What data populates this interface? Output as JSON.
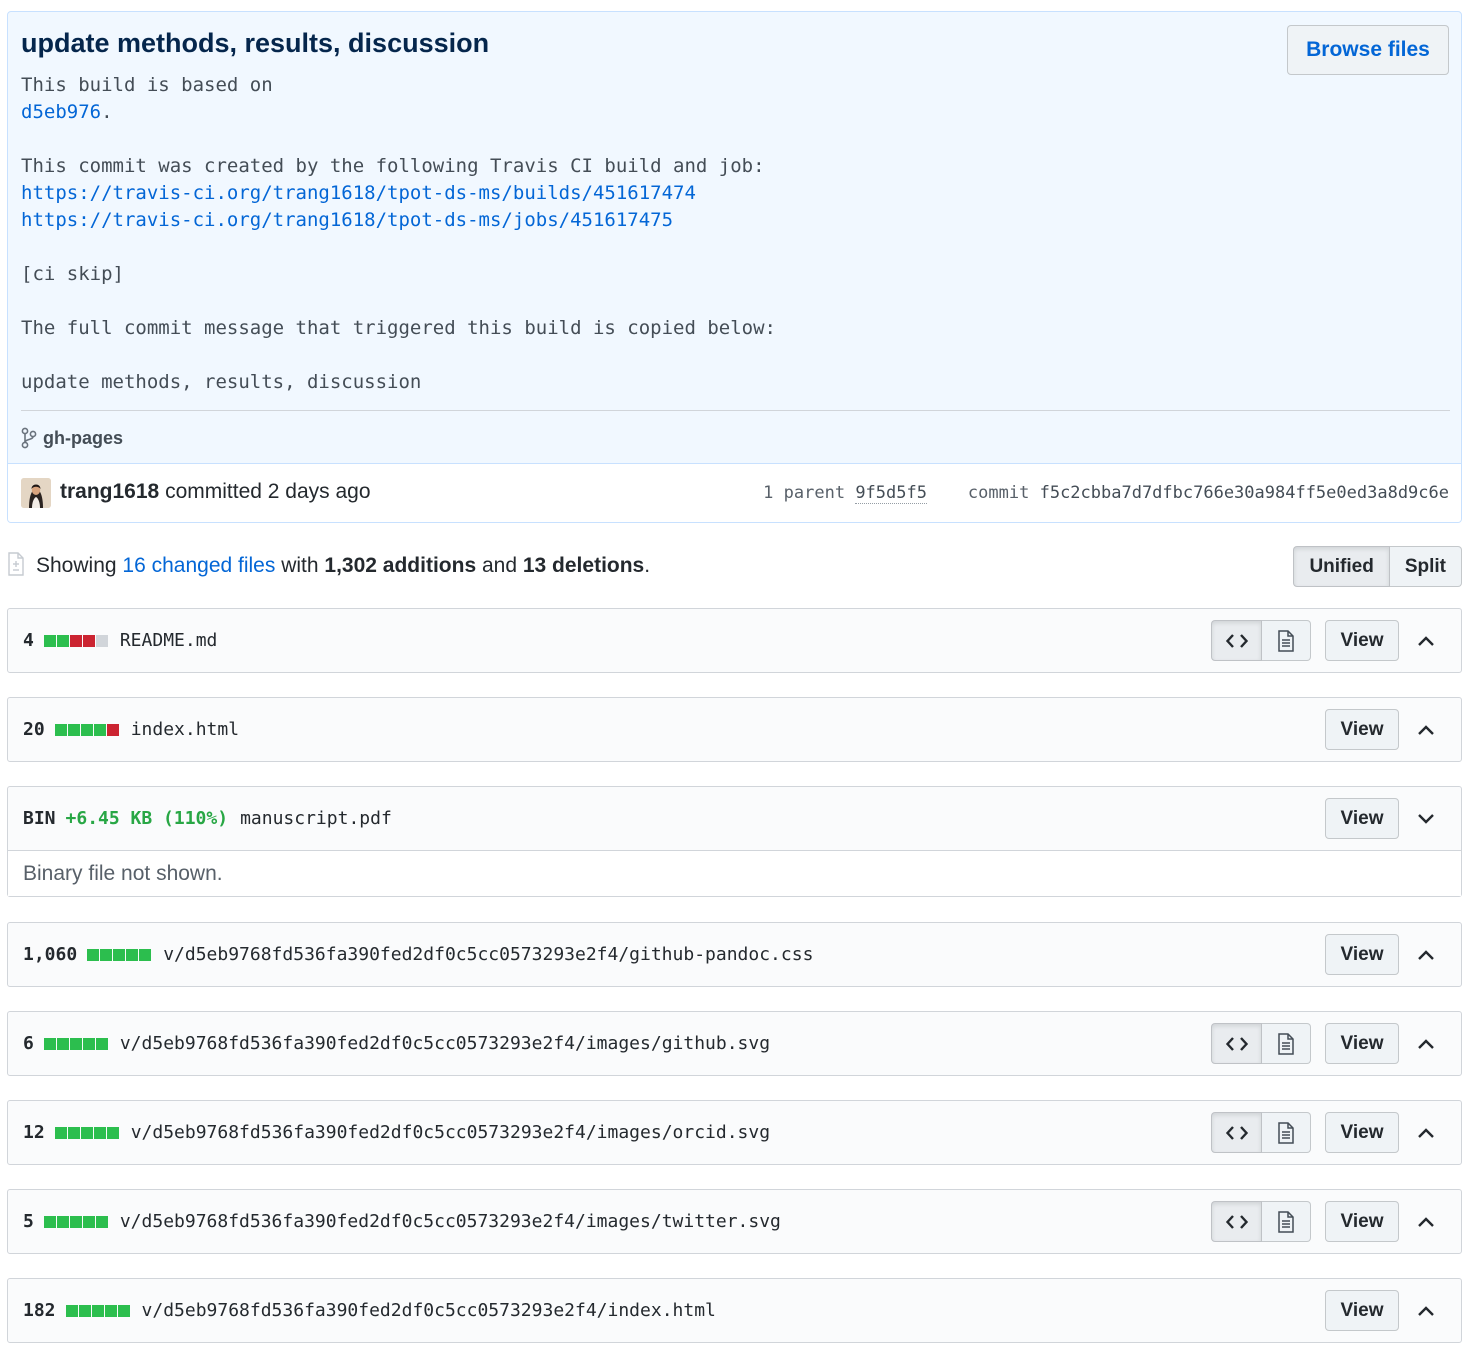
{
  "commit": {
    "title": "update methods, results, discussion",
    "browse_files_label": "Browse files",
    "description_lines": [
      "This build is based on",
      "",
      "",
      "This commit was created by the following Travis CI build and job:",
      "",
      "",
      "",
      "[ci skip]",
      "",
      "The full commit message that triggered this build is copied below:",
      "",
      "update methods, results, discussion"
    ],
    "base_sha_link": "d5eb976",
    "base_sha_suffix": ".",
    "build_url": "https://travis-ci.org/trang1618/tpot-ds-ms/builds/451617474",
    "job_url": "https://travis-ci.org/trang1618/tpot-ds-ms/jobs/451617475",
    "branch": "gh-pages",
    "author": "trang1618",
    "committed_text": "committed 2 days ago",
    "parent_label": "1 parent",
    "parent_sha": "9f5d5f5",
    "commit_label": "commit",
    "commit_sha": "f5c2cbba7d7dfbc766e30a984ff5e0ed3a8d9c6e"
  },
  "toc": {
    "showing": "Showing",
    "changed_files": "16 changed files",
    "with": "with",
    "additions": "1,302 additions",
    "and": "and",
    "deletions": "13 deletions",
    "period": ".",
    "unified_label": "Unified",
    "split_label": "Split"
  },
  "files": [
    {
      "stat": "4",
      "blocks": [
        "g",
        "g",
        "r",
        "r",
        "n"
      ],
      "name": "README.md",
      "toggle": true,
      "view": "View",
      "chevron": "up"
    },
    {
      "stat": "20",
      "blocks": [
        "g",
        "g",
        "g",
        "g",
        "r"
      ],
      "name": "index.html",
      "toggle": false,
      "view": "View",
      "chevron": "up"
    },
    {
      "stat": "BIN",
      "extra": "+6.45 KB (110%)",
      "blocks": [],
      "name": "manuscript.pdf",
      "toggle": false,
      "view": "View",
      "chevron": "down",
      "body": "Binary file not shown."
    },
    {
      "stat": "1,060",
      "blocks": [
        "g",
        "g",
        "g",
        "g",
        "g"
      ],
      "name": "v/d5eb9768fd536fa390fed2df0c5cc0573293e2f4/github-pandoc.css",
      "toggle": false,
      "view": "View",
      "chevron": "up"
    },
    {
      "stat": "6",
      "blocks": [
        "g",
        "g",
        "g",
        "g",
        "g"
      ],
      "name": "v/d5eb9768fd536fa390fed2df0c5cc0573293e2f4/images/github.svg",
      "toggle": true,
      "view": "View",
      "chevron": "up"
    },
    {
      "stat": "12",
      "blocks": [
        "g",
        "g",
        "g",
        "g",
        "g"
      ],
      "name": "v/d5eb9768fd536fa390fed2df0c5cc0573293e2f4/images/orcid.svg",
      "toggle": true,
      "view": "View",
      "chevron": "up"
    },
    {
      "stat": "5",
      "blocks": [
        "g",
        "g",
        "g",
        "g",
        "g"
      ],
      "name": "v/d5eb9768fd536fa390fed2df0c5cc0573293e2f4/images/twitter.svg",
      "toggle": true,
      "view": "View",
      "chevron": "up"
    },
    {
      "stat": "182",
      "blocks": [
        "g",
        "g",
        "g",
        "g",
        "g"
      ],
      "name": "v/d5eb9768fd536fa390fed2df0c5cc0573293e2f4/index.html",
      "toggle": false,
      "view": "View",
      "chevron": "up"
    }
  ],
  "colors": {
    "link": "#0366d6",
    "addition": "#2cbe4e",
    "deletion": "#cb2431",
    "neutral": "#d1d5da",
    "commit_bg": "#f1f8ff"
  }
}
